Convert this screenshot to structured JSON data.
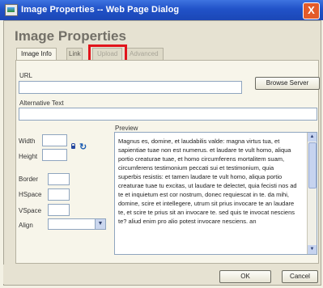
{
  "window": {
    "title": "Image Properties -- Web Page Dialog",
    "close_glyph": "X"
  },
  "dialog": {
    "heading": "Image Properties"
  },
  "tabs": [
    {
      "label": "Image Info",
      "state": "active"
    },
    {
      "label": "Link",
      "state": "inactive"
    },
    {
      "label": "Upload",
      "state": "disabled"
    },
    {
      "label": "Advanced",
      "state": "disabled"
    }
  ],
  "fields": {
    "url_label": "URL",
    "url_value": "",
    "browse_label": "Browse Server",
    "alt_label": "Alternative Text",
    "alt_value": "",
    "width_label": "Width",
    "height_label": "Height",
    "border_label": "Border",
    "hspace_label": "HSpace",
    "vspace_label": "VSpace",
    "align_label": "Align",
    "align_value": ""
  },
  "icons": {
    "lock": "lock-icon",
    "reset": "reset-size-icon",
    "reset_glyph": "↻"
  },
  "preview": {
    "label": "Preview",
    "text": "Magnus es, domine, et laudabilis valde: magna virtus tua, et sapientiae tuae non est numerus. et laudare te vult homo, aliqua portio creaturae tuae, et homo circumferens mortalitem suam, circumferens testimonium peccati sui et testimonium, quia superbis resistis: et tamen laudare te vult homo, aliqua portio creaturae tuae tu excitas, ut laudare te delectet, quia fecisti nos ad te et inquietum est cor nostrum, donec requiescat in te. da mihi, domine, scire et intellegere, utrum sit prius invocare te an laudare te, et scire te prius sit an invocare te. sed quis te invocat nesciens te? aliud enim pro alio potest invocare nesciens. an"
  },
  "footer": {
    "ok_label": "OK",
    "cancel_label": "Cancel"
  },
  "colors": {
    "titlebar": "#2152c8",
    "highlight": "#e1141b",
    "dialog_bg": "#e6e2d2"
  }
}
